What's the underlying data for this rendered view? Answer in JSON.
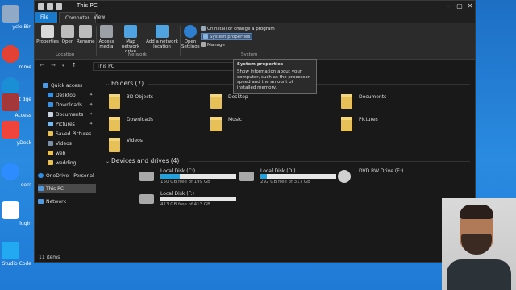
{
  "window": {
    "title": "This PC"
  },
  "tabs": [
    {
      "label": "File"
    },
    {
      "label": "Computer"
    },
    {
      "label": "View"
    }
  ],
  "ribbon": {
    "buttons": [
      {
        "label": "Properties"
      },
      {
        "label": "Open"
      },
      {
        "label": "Rename"
      },
      {
        "label": "Access media"
      },
      {
        "label": "Map network drive"
      },
      {
        "label": "Add a network location"
      },
      {
        "label": "Open Settings"
      }
    ],
    "small": [
      {
        "label": "Uninstall or change a program"
      },
      {
        "label": "System properties"
      },
      {
        "label": "Manage"
      }
    ],
    "groups": [
      {
        "label": "Location"
      },
      {
        "label": "Network"
      },
      {
        "label": "System"
      }
    ]
  },
  "address": {
    "path": "This PC"
  },
  "tooltip": {
    "title": "System properties",
    "body": "Show information about your computer, such as the processor speed and the amount of installed memory."
  },
  "nav": [
    {
      "label": "Quick access"
    },
    {
      "label": "Desktop"
    },
    {
      "label": "Downloads"
    },
    {
      "label": "Documents"
    },
    {
      "label": "Pictures"
    },
    {
      "label": "Saved Pictures"
    },
    {
      "label": "Videos"
    },
    {
      "label": "web"
    },
    {
      "label": "wedding"
    },
    {
      "label": "OneDrive - Personal"
    },
    {
      "label": "This PC"
    },
    {
      "label": "Network"
    }
  ],
  "folders": {
    "heading": "Folders (7)",
    "items": [
      {
        "label": "3D Objects"
      },
      {
        "label": "Desktop"
      },
      {
        "label": "Documents"
      },
      {
        "label": "Downloads"
      },
      {
        "label": "Music"
      },
      {
        "label": "Pictures"
      },
      {
        "label": "Videos"
      }
    ]
  },
  "drives": {
    "heading": "Devices and drives (4)",
    "items": [
      {
        "label": "Local Disk (C:)",
        "free": "150 GB free of 199 GB",
        "used_fraction": 0.25
      },
      {
        "label": "Local Disk (D:)",
        "free": "292 GB free of 317 GB",
        "used_fraction": 0.08
      },
      {
        "label": "DVD RW Drive (E:)"
      },
      {
        "label": "Local Disk (F:)",
        "free": "413 GB free of 413 GB",
        "used_fraction": 0.0
      }
    ]
  },
  "status": {
    "items": "11 items"
  },
  "desktop_icons": [
    {
      "label": "ycle Bin",
      "color": "#8fa9c7"
    },
    {
      "label": "rome",
      "color": "#e34133"
    },
    {
      "label": "rosoft dge",
      "color": "#1a8fd6"
    },
    {
      "label": "Access",
      "color": "#a4373a"
    },
    {
      "label": "yDesk",
      "color": "#ef443b"
    },
    {
      "label": "oom",
      "color": "#2d8cff"
    },
    {
      "label": "lugin",
      "color": "#ffffff"
    },
    {
      "label": "Studio Code",
      "color": "#23a9f2"
    }
  ]
}
